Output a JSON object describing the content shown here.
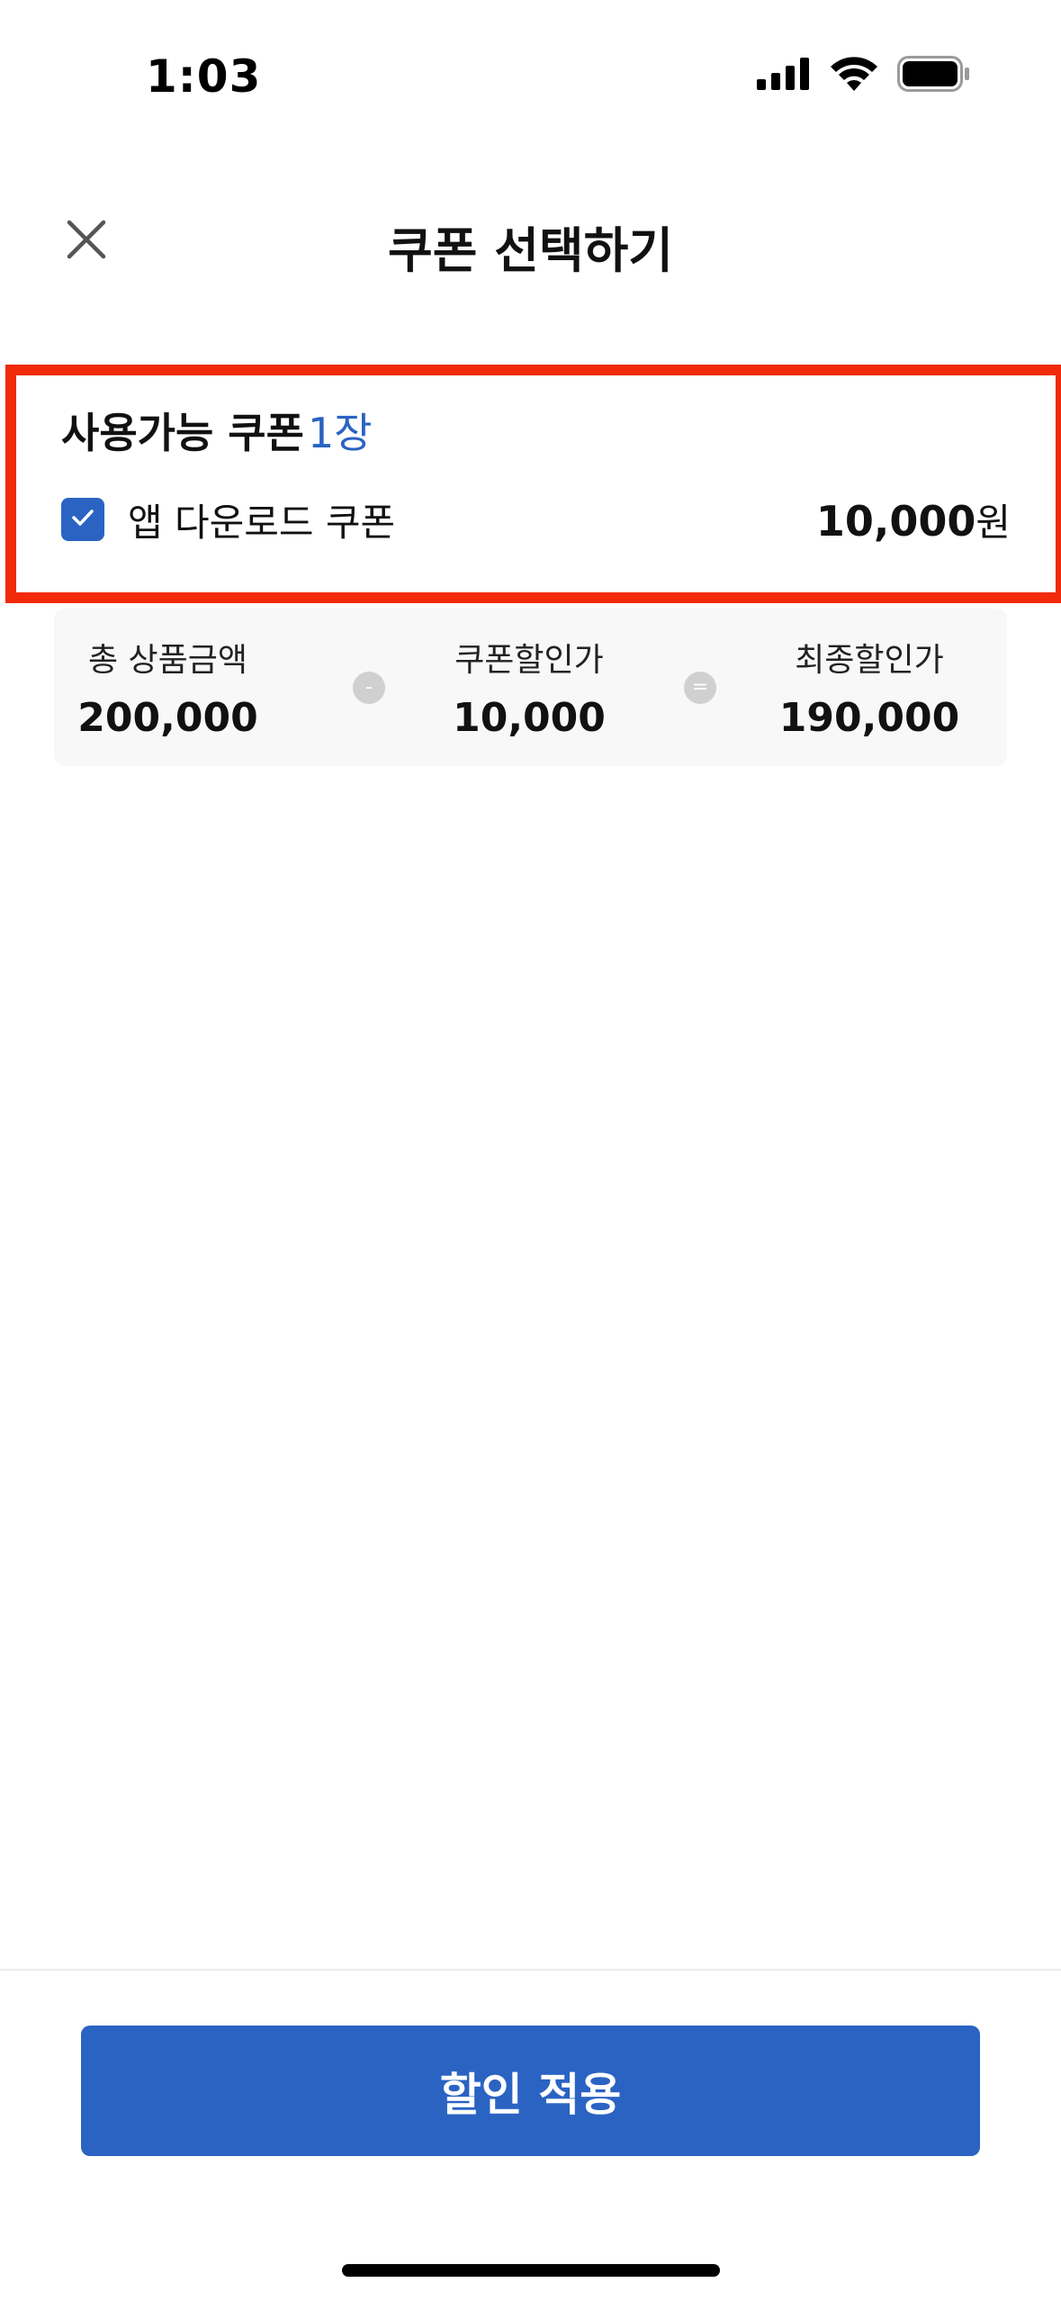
{
  "status_bar": {
    "time": "1:03",
    "icons": [
      "cellular-signal-icon",
      "wifi-icon",
      "battery-icon"
    ]
  },
  "header": {
    "title": "쿠폰 선택하기",
    "close_icon": "close-icon"
  },
  "coupons": {
    "heading": "사용가능 쿠폰",
    "count": "1장",
    "items": [
      {
        "name": "앱 다운로드 쿠폰",
        "amount": "10,000",
        "unit": "원",
        "checked": true
      }
    ]
  },
  "summary": {
    "total_label": "총 상품금액",
    "total_value": "200,000",
    "minus_symbol": "-",
    "discount_label": "쿠폰할인가",
    "discount_value": "10,000",
    "equals_symbol": "=",
    "final_label": "최종할인가",
    "final_value": "190,000"
  },
  "footer": {
    "apply_label": "할인 적용"
  },
  "colors": {
    "accent": "#2a63c2",
    "highlight_border": "#f02a0a",
    "summary_bg": "#f8f8f8"
  }
}
